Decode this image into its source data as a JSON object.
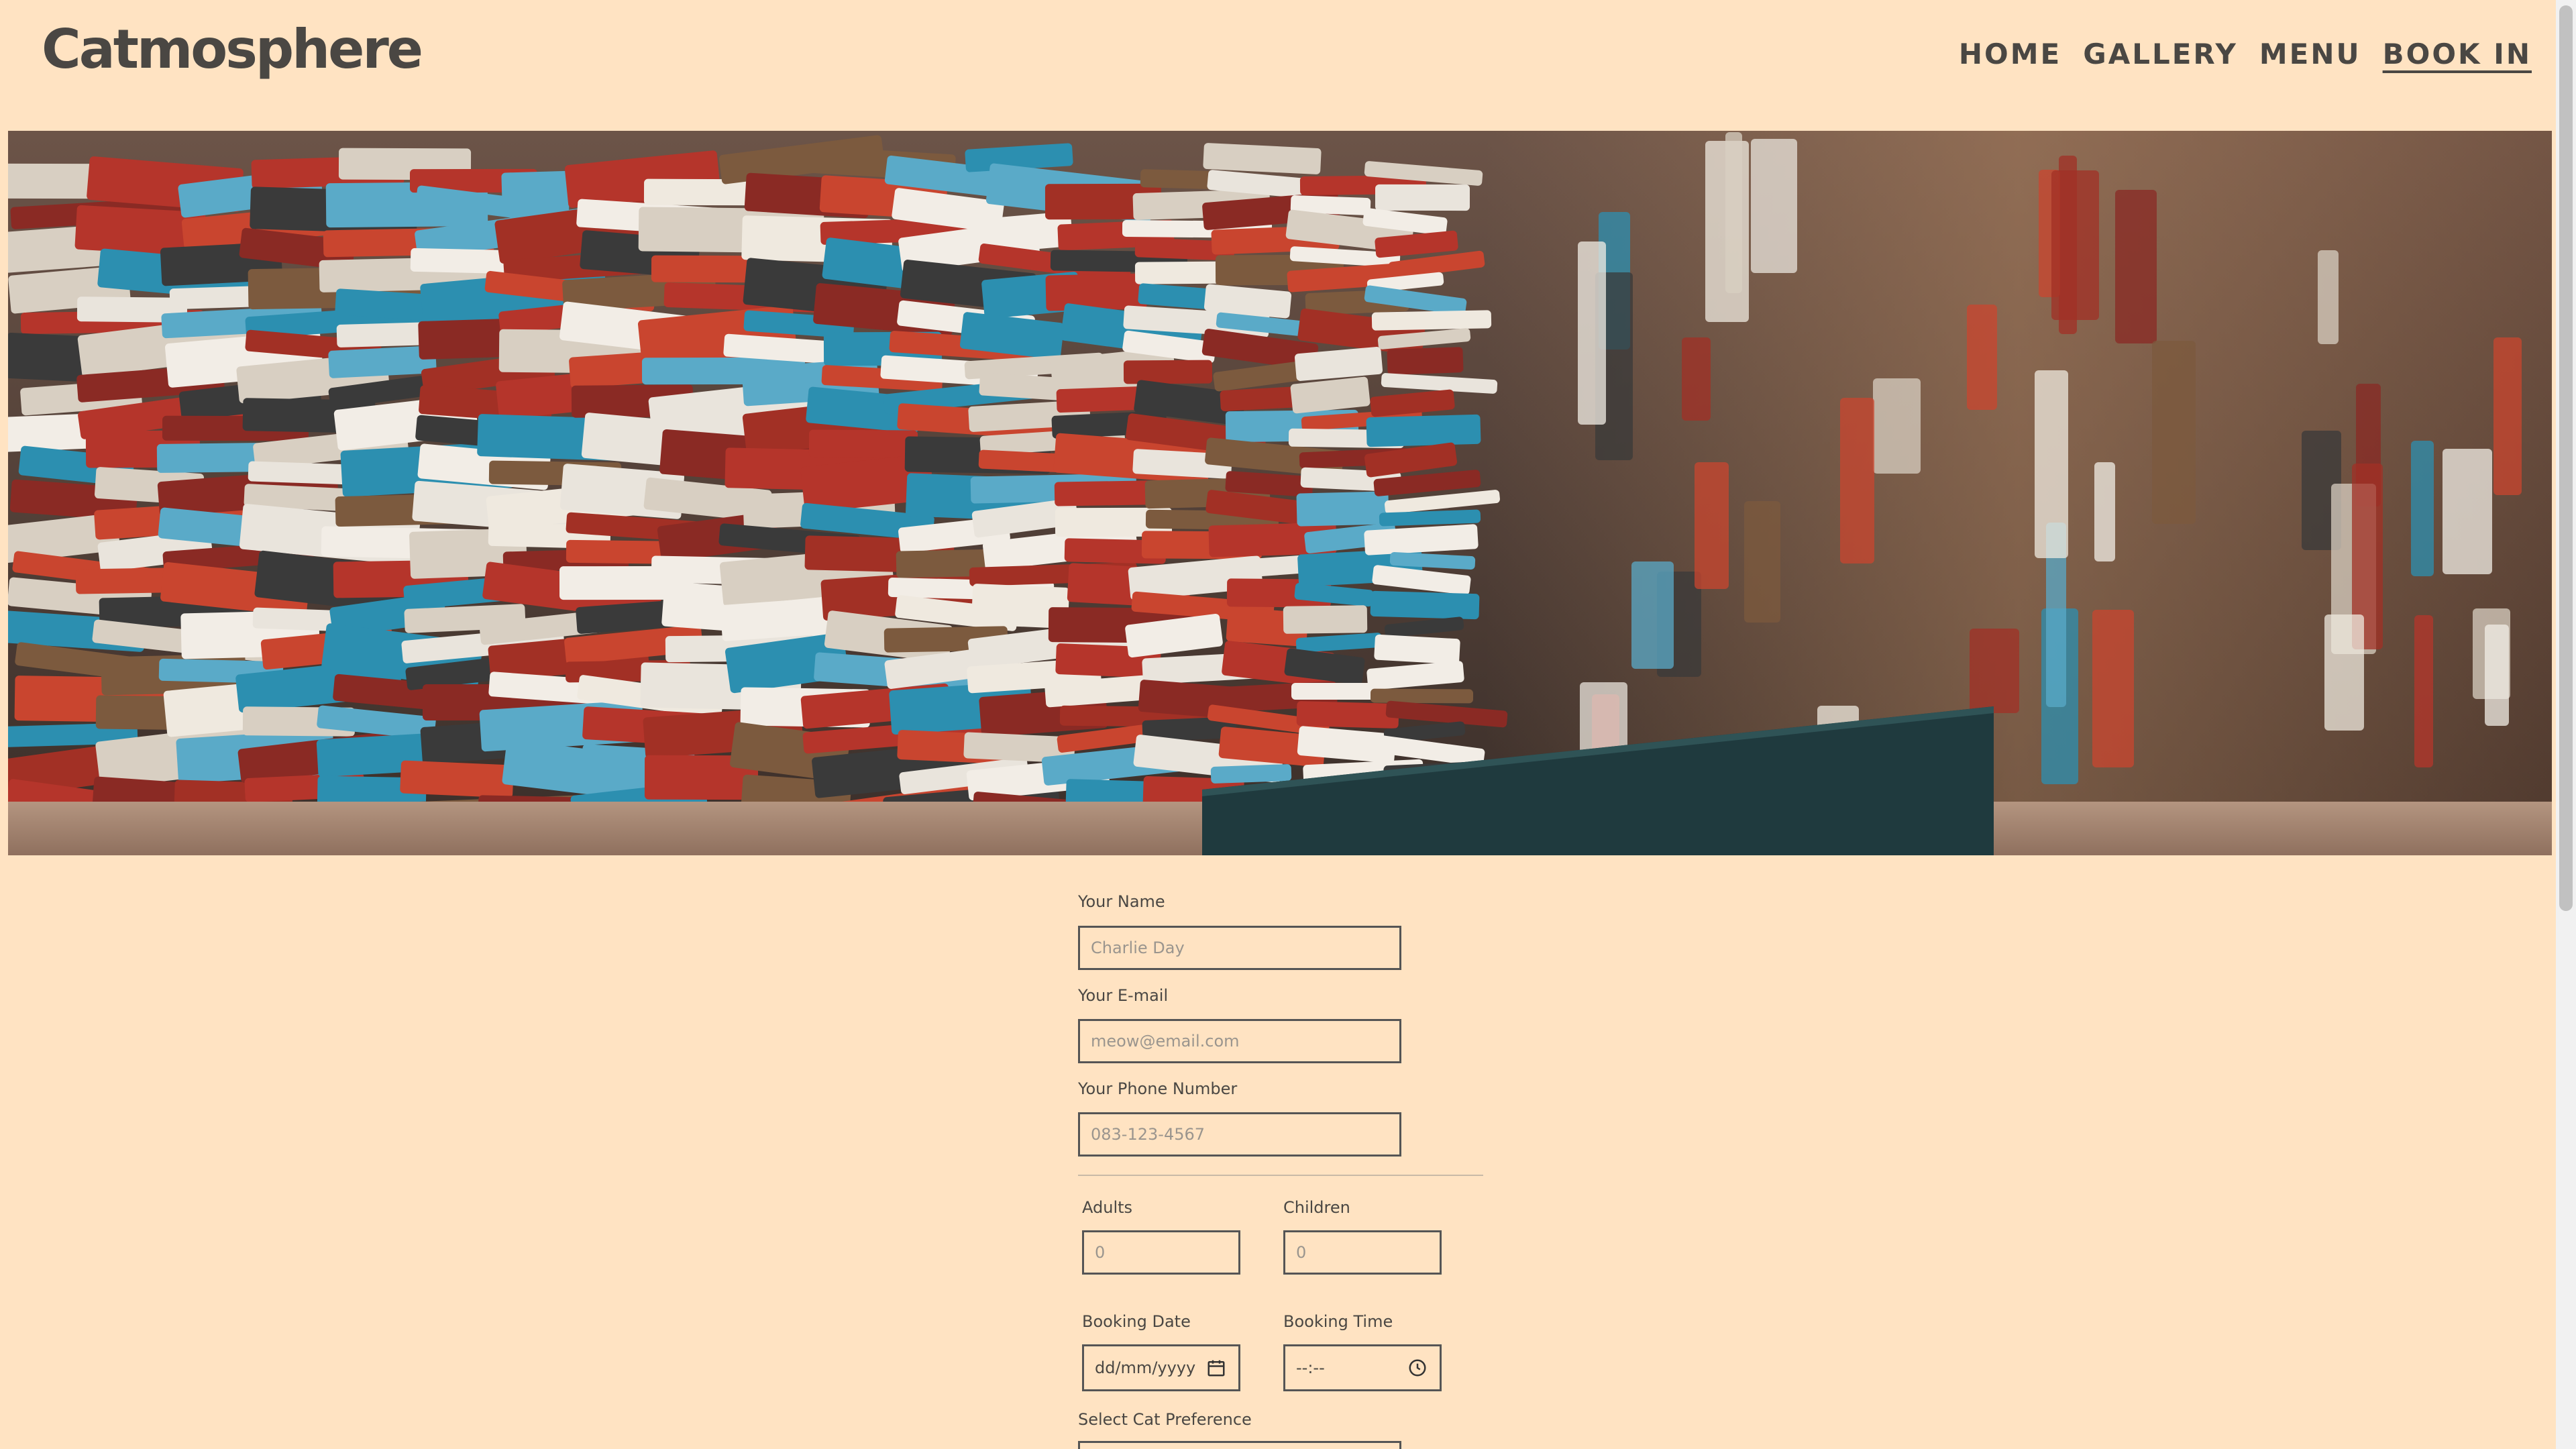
{
  "header": {
    "logo": "Catmosphere",
    "nav": [
      "HOME",
      "GALLERY",
      "MENU",
      "BOOK IN"
    ]
  },
  "form": {
    "name": {
      "label": "Your Name",
      "placeholder": "Charlie Day"
    },
    "email": {
      "label": "Your E-mail",
      "placeholder": "meow@email.com"
    },
    "phone": {
      "label": "Your Phone Number",
      "placeholder": "083-123-4567"
    },
    "adults": {
      "label": "Adults",
      "placeholder": "0"
    },
    "children": {
      "label": "Children",
      "placeholder": "0"
    },
    "date": {
      "label": "Booking Date",
      "placeholder": "dd/mm/yyyy"
    },
    "time": {
      "label": "Booking Time",
      "placeholder": "--:--"
    },
    "cat_pref": {
      "label": "Select Cat Preference"
    }
  },
  "colors": {
    "background": "#ffe3c2",
    "text": "#4a4743"
  }
}
